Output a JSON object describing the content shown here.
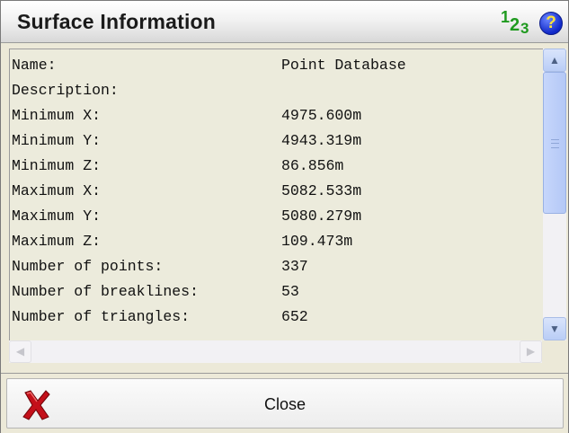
{
  "window": {
    "title": "Surface Information",
    "units_icon": {
      "name": "units-icon",
      "digits": [
        "1",
        "2",
        "3"
      ],
      "color": "#1f9a1f"
    },
    "help_icon": {
      "name": "help-icon",
      "glyph": "?"
    }
  },
  "info_rows": [
    {
      "label": "Name:",
      "value": "Point Database"
    },
    {
      "label": "Description:",
      "value": ""
    },
    {
      "label": "Minimum X:",
      "value": "4975.600m"
    },
    {
      "label": "Minimum Y:",
      "value": "4943.319m"
    },
    {
      "label": "Minimum Z:",
      "value": "86.856m"
    },
    {
      "label": "Maximum X:",
      "value": "5082.533m"
    },
    {
      "label": "Maximum Y:",
      "value": "5080.279m"
    },
    {
      "label": "Maximum Z:",
      "value": "109.473m"
    },
    {
      "label": "Number of points:",
      "value": "337"
    },
    {
      "label": "Number of breaklines:",
      "value": "53"
    },
    {
      "label": "Number of triangles:",
      "value": "652"
    }
  ],
  "scrollbars": {
    "up_icon": "scroll-up-icon",
    "down_icon": "scroll-down-icon",
    "left_icon": "scroll-left-icon",
    "right_icon": "scroll-right-icon"
  },
  "actions": {
    "close_label": "Close",
    "close_icon": "red-x-icon",
    "close_icon_color": "#c4101a"
  }
}
